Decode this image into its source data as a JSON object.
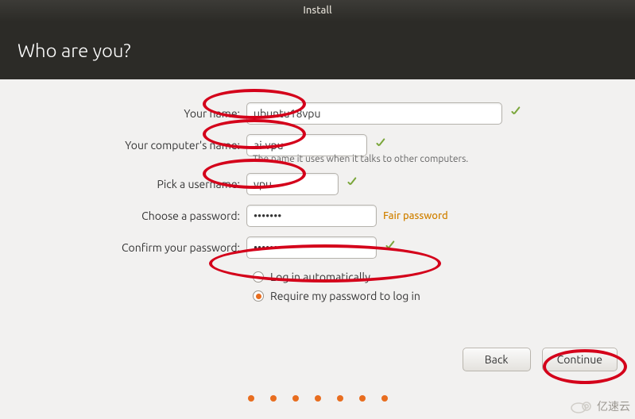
{
  "window": {
    "title": "Install"
  },
  "header": {
    "title": "Who are you?"
  },
  "form": {
    "name": {
      "label": "Your name:",
      "value": "ubuntu18vpu"
    },
    "computer": {
      "label": "Your computer's name:",
      "value": "ai-vpu",
      "hint": "The name it uses when it talks to other computers."
    },
    "username": {
      "label": "Pick a username:",
      "value": "vpu"
    },
    "password": {
      "label": "Choose a password:",
      "value": "•••••••",
      "strength": "Fair password"
    },
    "confirm": {
      "label": "Confirm your password:",
      "value": "•••••••"
    },
    "auto_login": {
      "label": "Log in automatically",
      "selected": false
    },
    "require_login": {
      "label": "Require my password to log in",
      "selected": true
    }
  },
  "buttons": {
    "back": "Back",
    "continue": "Continue"
  },
  "watermark": "亿速云"
}
